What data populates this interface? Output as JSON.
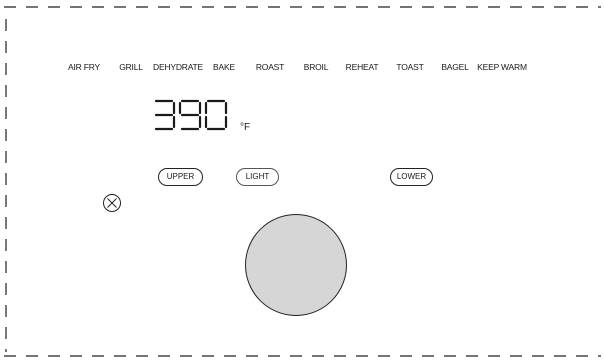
{
  "modes": [
    "AIR FRY",
    "GRILL",
    "DEHYDRATE",
    "BAKE",
    "ROAST",
    "BROIL",
    "REHEAT",
    "TOAST",
    "BAGEL",
    "KEEP WARM"
  ],
  "display": {
    "temperature": "390",
    "unit": "°F"
  },
  "buttons": {
    "upper": "UPPER",
    "light": "LIGHT",
    "lower": "LOWER"
  },
  "colors": {
    "knob": "#d6d6d6",
    "outline": "#222222"
  }
}
